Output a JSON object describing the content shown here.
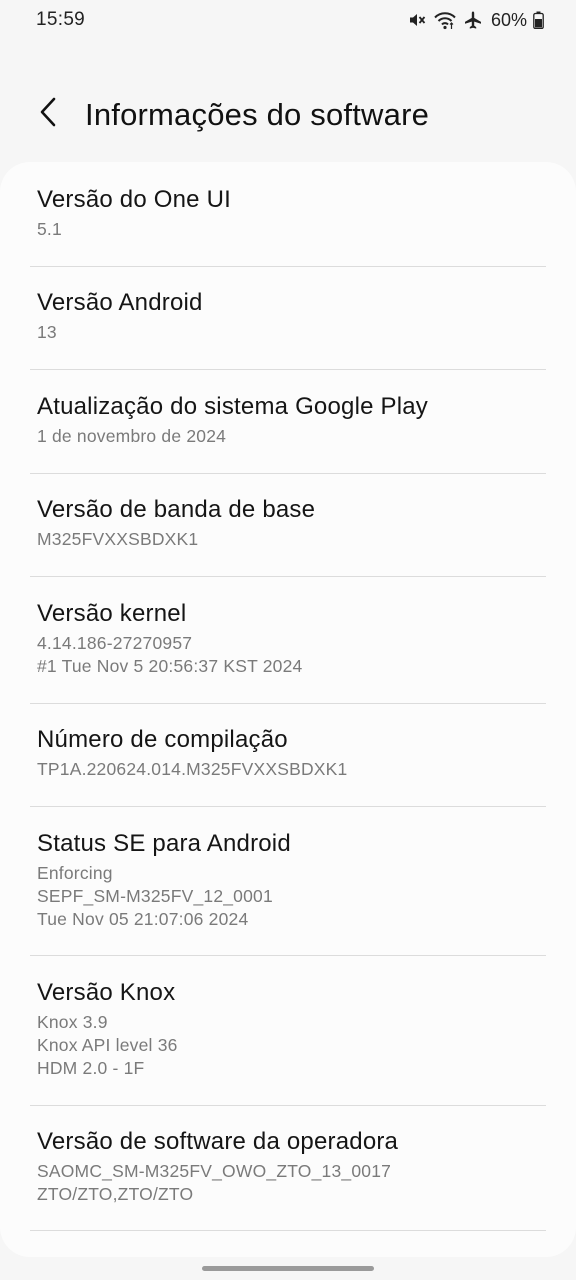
{
  "status_bar": {
    "time": "15:59",
    "battery": "60%",
    "icons": [
      "mute-icon",
      "wifi-icon",
      "airplane-mode-icon",
      "battery-icon"
    ]
  },
  "header": {
    "back_icon": "chevron-left-icon",
    "title": "Informações do software"
  },
  "items": [
    {
      "title": "Versão do One UI",
      "lines": [
        "5.1"
      ]
    },
    {
      "title": "Versão Android",
      "lines": [
        "13"
      ]
    },
    {
      "title": "Atualização do sistema Google Play",
      "lines": [
        "1 de novembro de 2024"
      ]
    },
    {
      "title": "Versão de banda de base",
      "lines": [
        "M325FVXXSBDXK1"
      ]
    },
    {
      "title": "Versão kernel",
      "lines": [
        "4.14.186-27270957",
        "#1 Tue Nov 5 20:56:37 KST 2024"
      ]
    },
    {
      "title": "Número de compilação",
      "lines": [
        "TP1A.220624.014.M325FVXXSBDXK1"
      ]
    },
    {
      "title": "Status SE para Android",
      "lines": [
        "Enforcing",
        "SEPF_SM-M325FV_12_0001",
        "Tue Nov 05 21:07:06 2024"
      ]
    },
    {
      "title": "Versão Knox",
      "lines": [
        "Knox 3.9",
        "Knox API level 36",
        "HDM 2.0 - 1F"
      ]
    },
    {
      "title": "Versão de software da operadora",
      "lines": [
        "SAOMC_SM-M325FV_OWO_ZTO_13_0017",
        "ZTO/ZTO,ZTO/ZTO"
      ]
    }
  ]
}
